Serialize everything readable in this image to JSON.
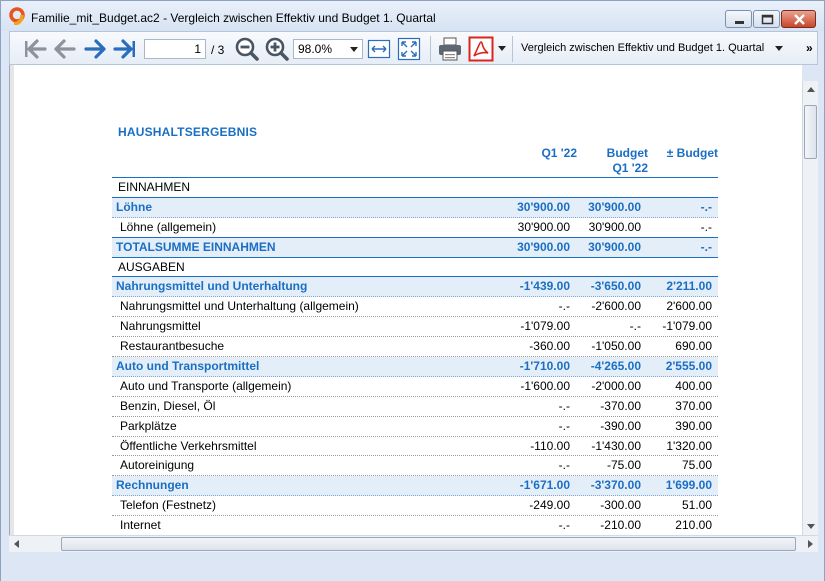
{
  "window": {
    "title": "Familie_mit_Budget.ac2 - Vergleich zwischen Effektiv und Budget 1. Quartal"
  },
  "toolbar": {
    "page_current": "1",
    "page_total": "/ 3",
    "zoom": "98.0%",
    "report_name": "Vergleich zwischen Effektiv und Budget 1. Quartal",
    "more": "»"
  },
  "colors": {
    "accent_blue": "#1a6fc4",
    "group_bg": "#e4eef9",
    "pdf_red": "#d9261c"
  },
  "report": {
    "title": "HAUSHALTSERGEBNIS",
    "columns": {
      "q1": "Q1 '22",
      "budget_line1": "Budget",
      "budget_line2": "Q1 '22",
      "diff": "± Budget"
    },
    "rows": [
      {
        "type": "section",
        "label": "EINNAHMEN",
        "q1": "",
        "budget": "",
        "diff": ""
      },
      {
        "type": "group",
        "label": "Löhne",
        "q1": "30'900.00",
        "budget": "30'900.00",
        "diff": "-.-"
      },
      {
        "type": "detail-last",
        "label": "Löhne (allgemein)",
        "q1": "30'900.00",
        "budget": "30'900.00",
        "diff": "-.-"
      },
      {
        "type": "total",
        "label": "TOTALSUMME EINNAHMEN",
        "q1": "30'900.00",
        "budget": "30'900.00",
        "diff": "-.-"
      },
      {
        "type": "section",
        "label": "AUSGABEN",
        "q1": "",
        "budget": "",
        "diff": ""
      },
      {
        "type": "group",
        "label": "Nahrungsmittel und Unterhaltung",
        "q1": "-1'439.00",
        "budget": "-3'650.00",
        "diff": "2'211.00"
      },
      {
        "type": "detail",
        "label": "Nahrungsmittel und Unterhaltung (allgemein)",
        "q1": "-.-",
        "budget": "-2'600.00",
        "diff": "2'600.00"
      },
      {
        "type": "detail",
        "label": "Nahrungsmittel",
        "q1": "-1'079.00",
        "budget": "-.-",
        "diff": "-1'079.00"
      },
      {
        "type": "detail",
        "label": "Restaurantbesuche",
        "q1": "-360.00",
        "budget": "-1'050.00",
        "diff": "690.00"
      },
      {
        "type": "group",
        "label": "Auto und Transportmittel",
        "q1": "-1'710.00",
        "budget": "-4'265.00",
        "diff": "2'555.00"
      },
      {
        "type": "detail",
        "label": "Auto und Transporte (allgemein)",
        "q1": "-1'600.00",
        "budget": "-2'000.00",
        "diff": "400.00"
      },
      {
        "type": "detail",
        "label": "Benzin, Diesel, Öl",
        "q1": "-.-",
        "budget": "-370.00",
        "diff": "370.00"
      },
      {
        "type": "detail",
        "label": "Parkplätze",
        "q1": "-.-",
        "budget": "-390.00",
        "diff": "390.00"
      },
      {
        "type": "detail",
        "label": "Öffentliche Verkehrsmittel",
        "q1": "-110.00",
        "budget": "-1'430.00",
        "diff": "1'320.00"
      },
      {
        "type": "detail",
        "label": "Autoreinigung",
        "q1": "-.-",
        "budget": "-75.00",
        "diff": "75.00"
      },
      {
        "type": "group",
        "label": "Rechnungen",
        "q1": "-1'671.00",
        "budget": "-3'370.00",
        "diff": "1'699.00"
      },
      {
        "type": "detail",
        "label": "Telefon (Festnetz)",
        "q1": "-249.00",
        "budget": "-300.00",
        "diff": "51.00"
      },
      {
        "type": "detail",
        "label": "Internet",
        "q1": "-.-",
        "budget": "-210.00",
        "diff": "210.00"
      }
    ]
  }
}
